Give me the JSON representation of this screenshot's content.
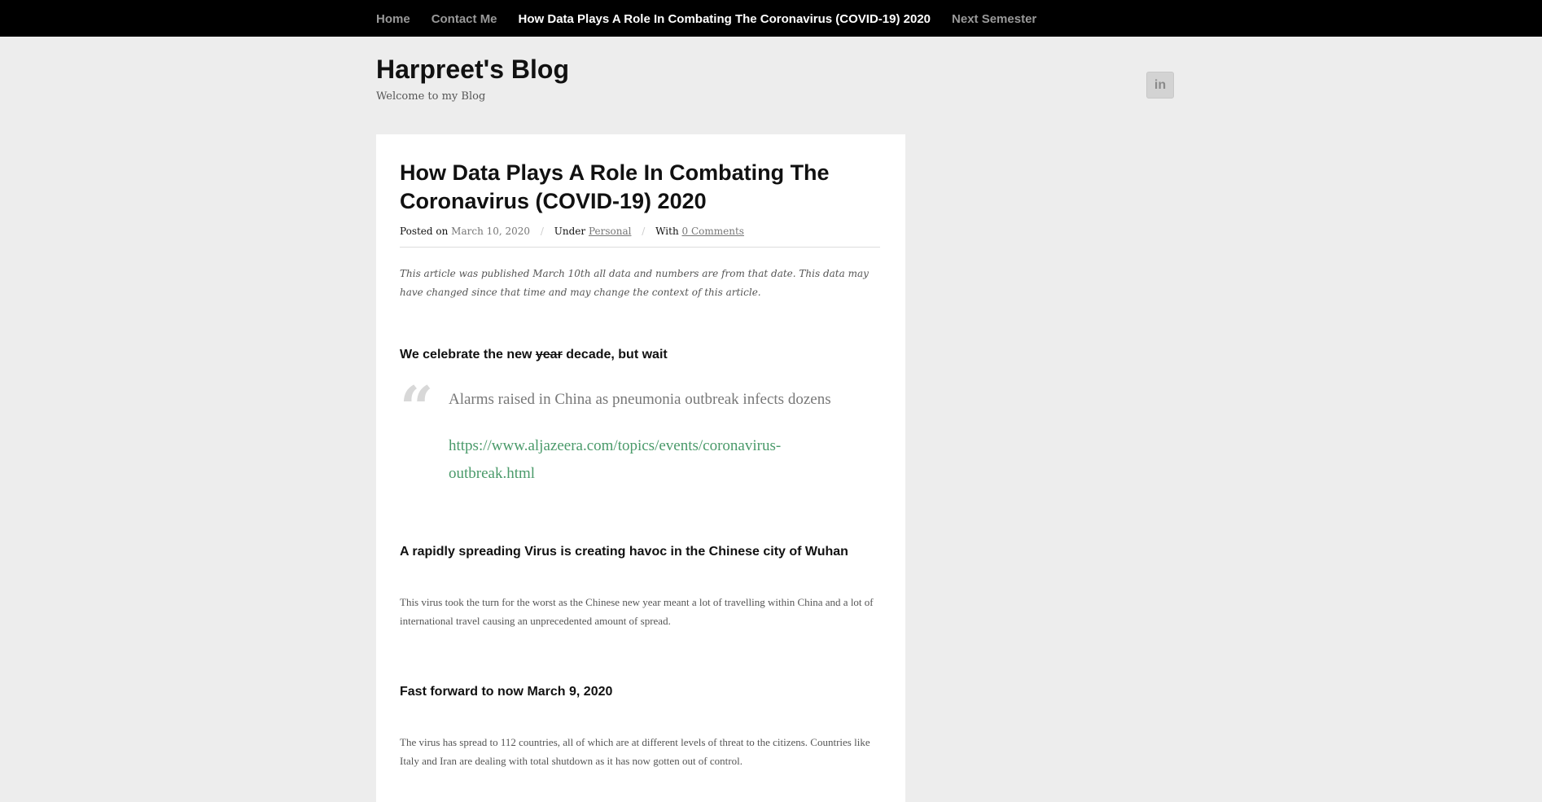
{
  "nav": {
    "items": [
      {
        "label": "Home"
      },
      {
        "label": "Contact Me"
      },
      {
        "label": "How Data Plays A Role In Combating The Coronavirus (COVID-19) 2020"
      },
      {
        "label": "Next Semester"
      }
    ]
  },
  "site": {
    "title": "Harpreet's Blog",
    "description": "Welcome to my Blog",
    "social_label": "in"
  },
  "post": {
    "title": "How Data Plays A Role In Combating The Coronavirus (COVID-19) 2020",
    "meta": {
      "posted_on_label": "Posted on",
      "date": "March 10, 2020",
      "sep": "/",
      "under_label": "Under",
      "category": "Personal",
      "with_label": "With",
      "comments": "0 Comments"
    },
    "note": "This article was published March 10th all data and numbers are from that date. This data may have changed since that time and may change the context of this article.",
    "heading1_before": "We celebrate the new ",
    "heading1_struck": "year",
    "heading1_after": " decade, but wait",
    "quote": {
      "icon": "quote-icon",
      "text": "Alarms raised in China as pneumonia outbreak infects dozens",
      "link": "https://www.aljazeera.com/topics/events/coronavirus-outbreak.html"
    },
    "heading2": "A rapidly spreading Virus is creating havoc in the Chinese city of Wuhan",
    "para2": "This virus took the turn for the worst as the Chinese new year meant a lot of travelling within China and a lot of international travel causing an unprecedented amount of spread.",
    "heading3": "Fast forward to now March 9, 2020",
    "para3": "The virus has spread to 112 countries, all of which are at different levels of threat to the citizens. Countries like Italy and Iran are dealing with total shutdown as it has now gotten out of control."
  },
  "colors": {
    "nav_bg": "#000000",
    "page_bg": "#ededed",
    "link_green": "#4a9a6a"
  }
}
